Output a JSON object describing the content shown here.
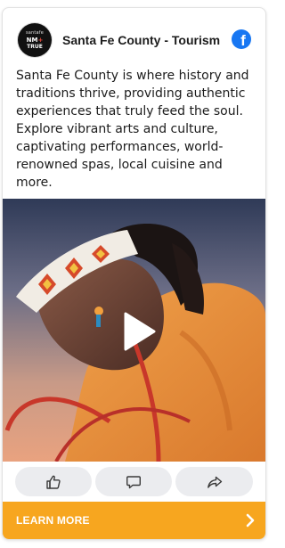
{
  "post": {
    "page_name": "Santa Fe County - Tourism",
    "avatar_logo": {
      "line1": "santafe",
      "line2_left": "NM",
      "line2_plus": "+",
      "line3": "TRUE"
    },
    "network_icon": "facebook-icon",
    "body": "Santa Fe County is where history and traditions thrive, providing authentic experiences that truly feed the soul. Explore vibrant arts and culture, captivating performances, world-renowned spas, local cuisine and more."
  },
  "media": {
    "type": "video",
    "play_icon": "play-icon"
  },
  "actions": [
    {
      "icon": "thumbs-up-icon"
    },
    {
      "icon": "comment-icon"
    },
    {
      "icon": "share-icon"
    }
  ],
  "cta": {
    "label": "LEARN MORE",
    "icon": "chevron-right-icon"
  },
  "colors": {
    "cta_background": "#f7a61f",
    "facebook_blue": "#1877f2",
    "action_button_background": "#ebecef"
  }
}
